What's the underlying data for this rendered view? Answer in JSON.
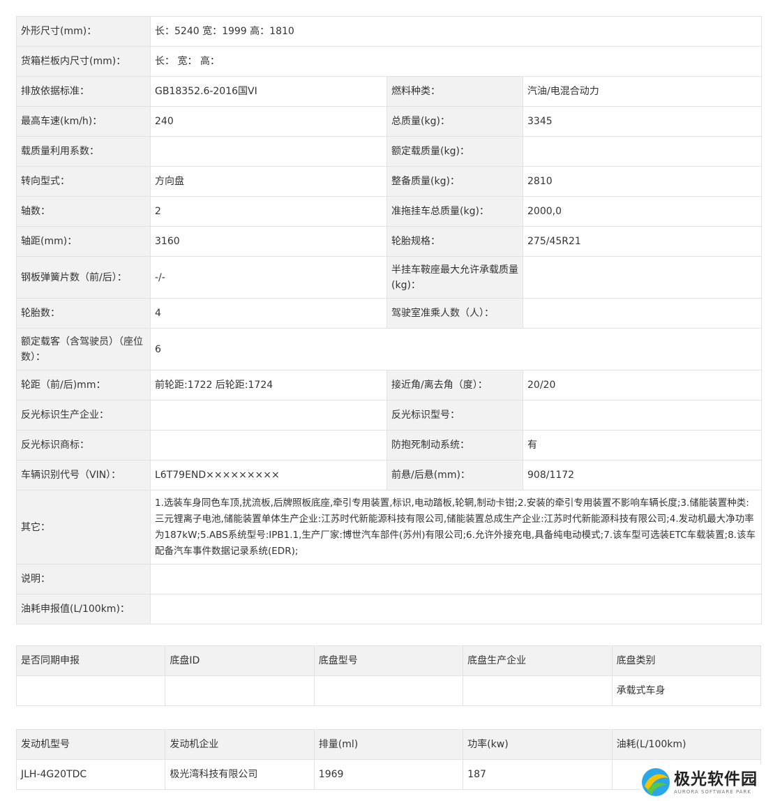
{
  "spec": {
    "dimensions": {
      "label": "外形尺寸(mm)：",
      "value": "长：5240 宽：1999 高：1810"
    },
    "cargo_box": {
      "label": "货箱栏板内尺寸(mm)：",
      "value": "长： 宽： 高："
    },
    "emission": {
      "label": "排放依据标准：",
      "value": "GB18352.6-2016国VI"
    },
    "fuel": {
      "label": "燃料种类：",
      "value": "汽油/电混合动力"
    },
    "max_speed": {
      "label": "最高车速(km/h)：",
      "value": "240"
    },
    "total_mass": {
      "label": "总质量(kg)：",
      "value": "3345"
    },
    "load_coef": {
      "label": "载质量利用系数：",
      "value": ""
    },
    "rated_load": {
      "label": "额定载质量(kg)：",
      "value": ""
    },
    "steering": {
      "label": "转向型式：",
      "value": "方向盘"
    },
    "curb_mass": {
      "label": "整备质量(kg)：",
      "value": "2810"
    },
    "axles": {
      "label": "轴数：",
      "value": "2"
    },
    "trailer_mass": {
      "label": "准拖挂车总质量(kg)：",
      "value": "2000,0"
    },
    "wheelbase": {
      "label": "轴距(mm)：",
      "value": "3160"
    },
    "tire_spec": {
      "label": "轮胎规格：",
      "value": "275/45R21"
    },
    "leaf_springs": {
      "label": "钢板弹簧片数（前/后）：",
      "value": "-/-"
    },
    "saddle_load": {
      "label": "半挂车鞍座最大允许承载质量(kg)：",
      "value": ""
    },
    "tires": {
      "label": "轮胎数：",
      "value": "4"
    },
    "cab_seats": {
      "label": "驾驶室准乘人数（人）：",
      "value": ""
    },
    "passengers": {
      "label": "额定载客（含驾驶员）（座位数）：",
      "value": "6"
    },
    "track": {
      "label": "轮距（前/后)mm：",
      "value": "前轮距:1722 后轮距:1724"
    },
    "angles": {
      "label": "接近角/离去角（度）：",
      "value": "20/20"
    },
    "reflector_maker": {
      "label": "反光标识生产企业：",
      "value": ""
    },
    "reflector_model": {
      "label": "反光标识型号：",
      "value": ""
    },
    "reflector_brand": {
      "label": "反光标识商标：",
      "value": ""
    },
    "abs": {
      "label": "防抱死制动系统：",
      "value": "有"
    },
    "vin": {
      "label": "车辆识别代号（VIN）：",
      "value": "L6T79END×××××××××"
    },
    "overhang": {
      "label": "前悬/后悬(mm)：",
      "value": "908/1172"
    },
    "other": {
      "label": "其它：",
      "value": "1.选装车身同色车顶,扰流板,后牌照板底座,牵引专用装置,标识,电动踏板,轮辋,制动卡钳;2.安装的牵引专用装置不影响车辆长度;3.储能装置种类:三元锂离子电池,储能装置单体生产企业:江苏时代新能源科技有限公司,储能装置总成生产企业:江苏时代新能源科技有限公司;4.发动机最大净功率为187kW;5.ABS系统型号:IPB1.1,生产厂家:博世汽车部件(苏州)有限公司;6.允许外接充电,具备纯电动模式;7.该车型可选装ETC车载装置;8.该车配备汽车事件数据记录系统(EDR);"
    },
    "note": {
      "label": "说明：",
      "value": ""
    },
    "fuel_consumption": {
      "label": "油耗申报值(L/100km)：",
      "value": ""
    }
  },
  "chassis": {
    "headers": [
      "是否同期申报",
      "底盘ID",
      "底盘型号",
      "底盘生产企业",
      "底盘类别"
    ],
    "row": [
      "",
      "",
      "",
      "",
      "承载式车身"
    ]
  },
  "engine": {
    "headers": [
      "发动机型号",
      "发动机企业",
      "排量(ml)",
      "功率(kw)",
      "油耗(L/100km)"
    ],
    "row": [
      "JLH-4G20TDC",
      "极光湾科技有限公司",
      "1969",
      "187",
      ""
    ]
  },
  "watermark": {
    "name": "极光软件园",
    "sub": "AURORA SOFTWARE PARK"
  },
  "colors": {
    "label_bg": "#f2f2f2",
    "border": "#e3e3e3",
    "text": "#333333"
  }
}
